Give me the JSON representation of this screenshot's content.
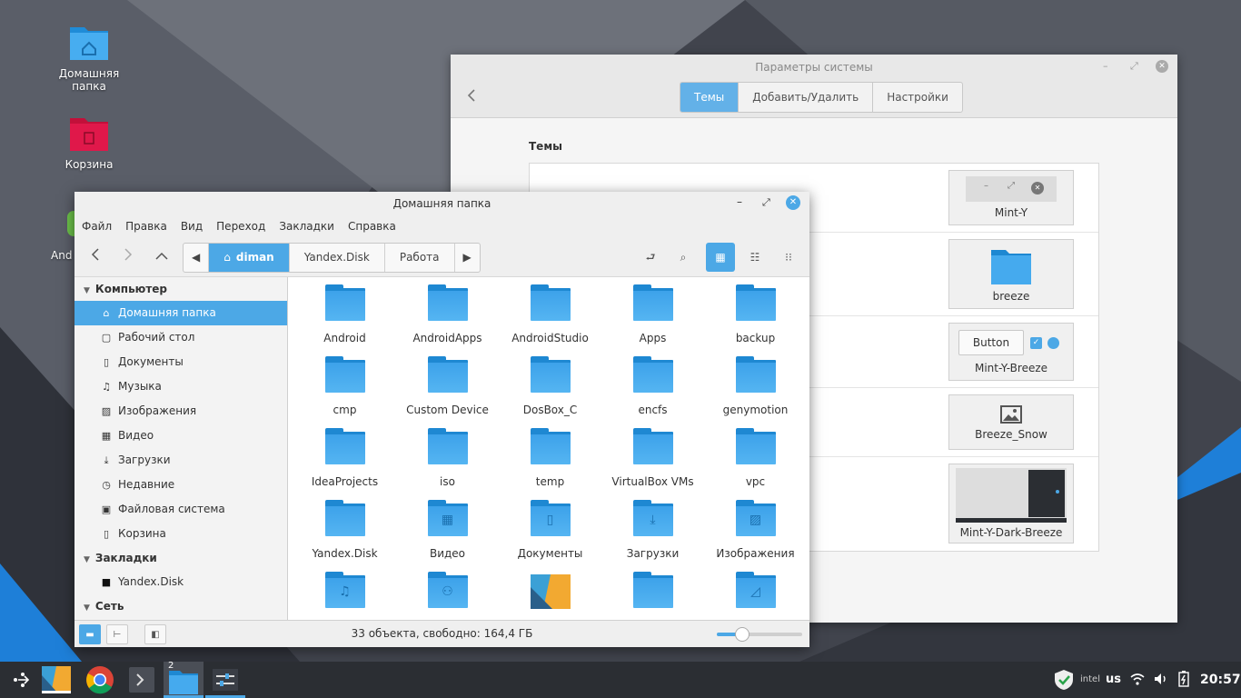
{
  "desktop": {
    "icons": [
      {
        "label": "Домашняя папка",
        "icon": "home-folder-icon"
      },
      {
        "label": "Корзина",
        "icon": "trash-folder-icon"
      },
      {
        "label": "And",
        "icon": "android-icon"
      }
    ],
    "colors": {
      "bg_dark": "#3d4049",
      "accent_blue": "#1e7fd8"
    }
  },
  "settings": {
    "title": "Параметры системы",
    "tabs": [
      {
        "label": "Темы",
        "active": true
      },
      {
        "label": "Добавить/Удалить",
        "active": false
      },
      {
        "label": "Настройки",
        "active": false
      }
    ],
    "section_title": "Темы",
    "theme_cards": [
      {
        "label": "Mint-Y",
        "preview": "window-controls"
      },
      {
        "label": "breeze",
        "preview": "folder-icon"
      },
      {
        "label": "Mint-Y-Breeze",
        "preview": "widgets",
        "button_label": "Button"
      },
      {
        "label": "Breeze_Snow",
        "preview": "image-icon"
      },
      {
        "label": "Mint-Y-Dark-Breeze",
        "preview": "desktop-thumbnail"
      }
    ]
  },
  "filemanager": {
    "title": "Домашняя папка",
    "menu": [
      "Файл",
      "Правка",
      "Вид",
      "Переход",
      "Закладки",
      "Справка"
    ],
    "path": [
      {
        "label": "diman",
        "active": true
      },
      {
        "label": "Yandex.Disk",
        "active": false
      },
      {
        "label": "Работа",
        "active": false
      }
    ],
    "sidebar": {
      "computer_header": "Компьютер",
      "computer_items": [
        {
          "label": "Домашняя папка",
          "icon": "home-icon",
          "selected": true
        },
        {
          "label": "Рабочий стол",
          "icon": "desktop-icon",
          "selected": false
        },
        {
          "label": "Документы",
          "icon": "document-icon",
          "selected": false
        },
        {
          "label": "Музыка",
          "icon": "music-icon",
          "selected": false
        },
        {
          "label": "Изображения",
          "icon": "image-icon",
          "selected": false
        },
        {
          "label": "Видео",
          "icon": "video-icon",
          "selected": false
        },
        {
          "label": "Загрузки",
          "icon": "download-icon",
          "selected": false
        },
        {
          "label": "Недавние",
          "icon": "clock-icon",
          "selected": false
        },
        {
          "label": "Файловая система",
          "icon": "drive-icon",
          "selected": false
        },
        {
          "label": "Корзина",
          "icon": "trash-icon",
          "selected": false
        }
      ],
      "bookmarks_header": "Закладки",
      "bookmark_items": [
        {
          "label": "Yandex.Disk",
          "icon": "folder-icon"
        }
      ],
      "network_header": "Сеть"
    },
    "files": [
      {
        "name": "Android",
        "glyph": ""
      },
      {
        "name": "AndroidApps",
        "glyph": ""
      },
      {
        "name": "AndroidStudio",
        "glyph": ""
      },
      {
        "name": "Apps",
        "glyph": ""
      },
      {
        "name": "backup",
        "glyph": ""
      },
      {
        "name": "cmp",
        "glyph": ""
      },
      {
        "name": "Custom Device",
        "glyph": ""
      },
      {
        "name": "DosBox_C",
        "glyph": ""
      },
      {
        "name": "encfs",
        "glyph": ""
      },
      {
        "name": "genymotion",
        "glyph": ""
      },
      {
        "name": "IdeaProjects",
        "glyph": ""
      },
      {
        "name": "iso",
        "glyph": ""
      },
      {
        "name": "temp",
        "glyph": ""
      },
      {
        "name": "VirtualBox VMs",
        "glyph": ""
      },
      {
        "name": "vpc",
        "glyph": ""
      },
      {
        "name": "Yandex.Disk",
        "glyph": ""
      },
      {
        "name": "Видео",
        "glyph": "▦"
      },
      {
        "name": "Документы",
        "glyph": "▯"
      },
      {
        "name": "Загрузки",
        "glyph": "⤓"
      },
      {
        "name": "Изображения",
        "glyph": "▨"
      },
      {
        "name": "",
        "glyph": "♫"
      },
      {
        "name": "",
        "glyph": "⚇"
      },
      {
        "name": "",
        "glyph": "image"
      },
      {
        "name": "",
        "glyph": ""
      },
      {
        "name": "",
        "glyph": "◿"
      }
    ],
    "status": "33 объекта, свободно: 164,4 ГБ",
    "zoom_level": 0.3
  },
  "taskbar": {
    "items": [
      "menu-icon",
      "kde-app-icon",
      "chrome-icon",
      "terminal-icon",
      "files-icon",
      "settings-icon"
    ],
    "files_badge": "2",
    "keyboard_layout": "us",
    "clock": "20:57"
  }
}
